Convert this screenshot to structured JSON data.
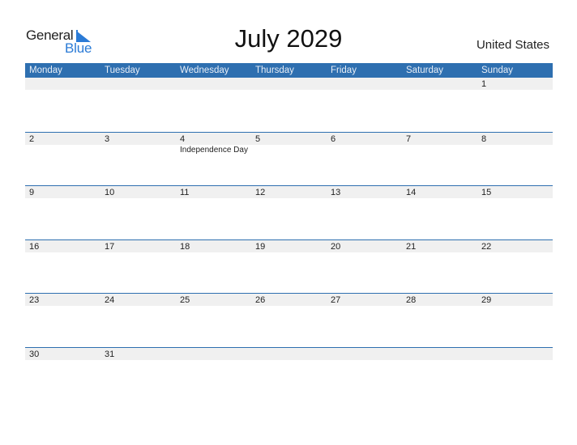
{
  "logo": {
    "line1": "General",
    "line2": "Blue"
  },
  "title": "July 2029",
  "country": "United States",
  "weekdays": [
    "Monday",
    "Tuesday",
    "Wednesday",
    "Thursday",
    "Friday",
    "Saturday",
    "Sunday"
  ],
  "weeks": [
    {
      "days": [
        "",
        "",
        "",
        "",
        "",
        "",
        "1"
      ],
      "events": [
        "",
        "",
        "",
        "",
        "",
        "",
        ""
      ]
    },
    {
      "days": [
        "2",
        "3",
        "4",
        "5",
        "6",
        "7",
        "8"
      ],
      "events": [
        "",
        "",
        "Independence Day",
        "",
        "",
        "",
        ""
      ]
    },
    {
      "days": [
        "9",
        "10",
        "11",
        "12",
        "13",
        "14",
        "15"
      ],
      "events": [
        "",
        "",
        "",
        "",
        "",
        "",
        ""
      ]
    },
    {
      "days": [
        "16",
        "17",
        "18",
        "19",
        "20",
        "21",
        "22"
      ],
      "events": [
        "",
        "",
        "",
        "",
        "",
        "",
        ""
      ]
    },
    {
      "days": [
        "23",
        "24",
        "25",
        "26",
        "27",
        "28",
        "29"
      ],
      "events": [
        "",
        "",
        "",
        "",
        "",
        "",
        ""
      ]
    },
    {
      "days": [
        "30",
        "31",
        "",
        "",
        "",
        "",
        ""
      ],
      "events": [
        "",
        "",
        "",
        "",
        "",
        "",
        ""
      ]
    }
  ],
  "colors": {
    "header": "#2e6fb0",
    "brand_blue": "#2b7bd6",
    "band": "#f0f0f0"
  }
}
